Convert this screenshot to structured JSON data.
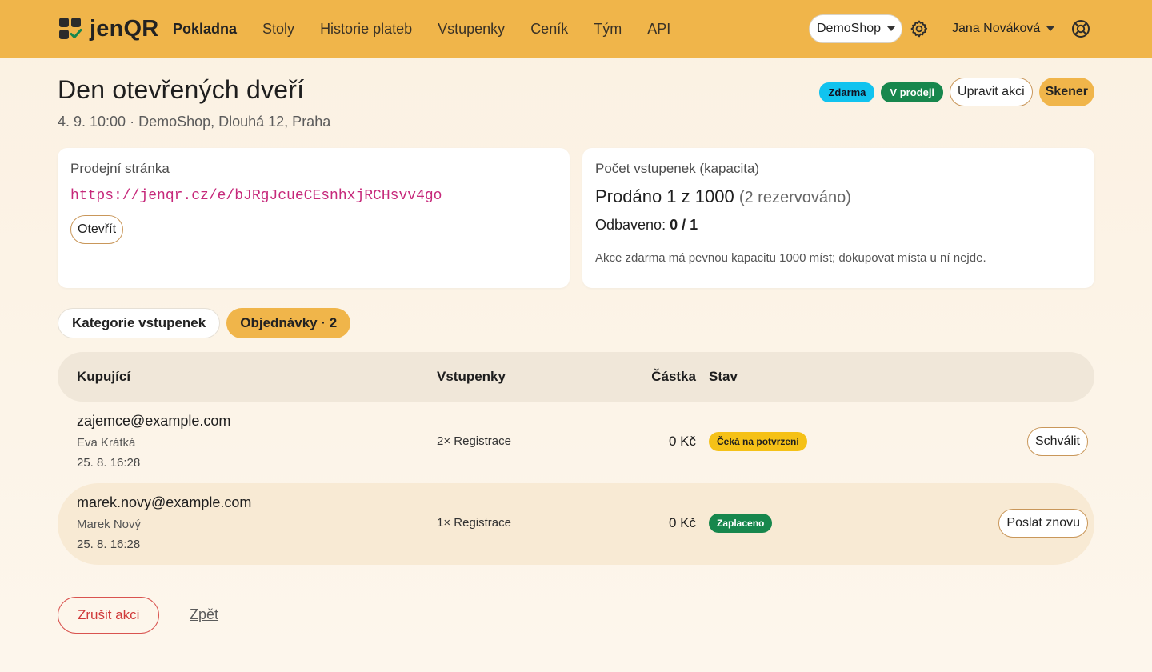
{
  "nav": {
    "brand": "jenQR",
    "links": [
      "Pokladna",
      "Stoly",
      "Historie plateb",
      "Vstupenky",
      "Ceník",
      "Tým",
      "API"
    ],
    "shop": "DemoShop",
    "user": "Jana Nováková"
  },
  "event": {
    "title": "Den otevřených dveří",
    "subtitle": "4. 9. 10:00 · DemoShop, Dlouhá 12, Praha",
    "badge_free": "Zdarma",
    "badge_sale": "V prodeji",
    "edit_label": "Upravit akci",
    "scanner_label": "Skener"
  },
  "sale_page": {
    "label": "Prodejní stránka",
    "url": "https://jenqr.cz/e/bJRgJcueCEsnhxjRCHsvv4go",
    "open_label": "Otevřít"
  },
  "capacity": {
    "label": "Počet vstupenek (kapacita)",
    "sold_text": "Prodáno 1 z 1000",
    "reserved_text": "(2 rezervováno)",
    "checked_label": "Odbaveno:",
    "checked_value": "0 / 1",
    "note": "Akce zdarma má pevnou kapacitu 1000 míst; dokupovat místa u ní nejde."
  },
  "tabs": {
    "categories": "Kategorie vstupenek",
    "orders": "Objednávky · 2"
  },
  "table": {
    "headers": {
      "buyer": "Kupující",
      "tickets": "Vstupenky",
      "amount": "Částka",
      "status": "Stav"
    },
    "rows": [
      {
        "email": "zajemce@example.com",
        "name": "Eva Krátká",
        "date": "25. 8. 16:28",
        "tickets": "2× Registrace",
        "amount": "0 Kč",
        "status": "Čeká na potvrzení",
        "action": "Schválit"
      },
      {
        "email": "marek.novy@example.com",
        "name": "Marek Nový",
        "date": "25. 8. 16:28",
        "tickets": "1× Registrace",
        "amount": "0 Kč",
        "status": "Zaplaceno",
        "action": "Poslat znovu"
      }
    ]
  },
  "footer": {
    "cancel_label": "Zrušit akci",
    "back_label": "Zpět"
  },
  "colors": {
    "navbar": "#f0b54a",
    "accent_green": "#17874d",
    "accent_cyan": "#11c3ef",
    "url_pink": "#c6287a",
    "danger": "#d03a3a"
  },
  "icons": {
    "brand": "qr-check-logo-icon",
    "settings": "gear-icon",
    "help": "lifebuoy-icon",
    "dropdown": "caret-down-icon"
  }
}
